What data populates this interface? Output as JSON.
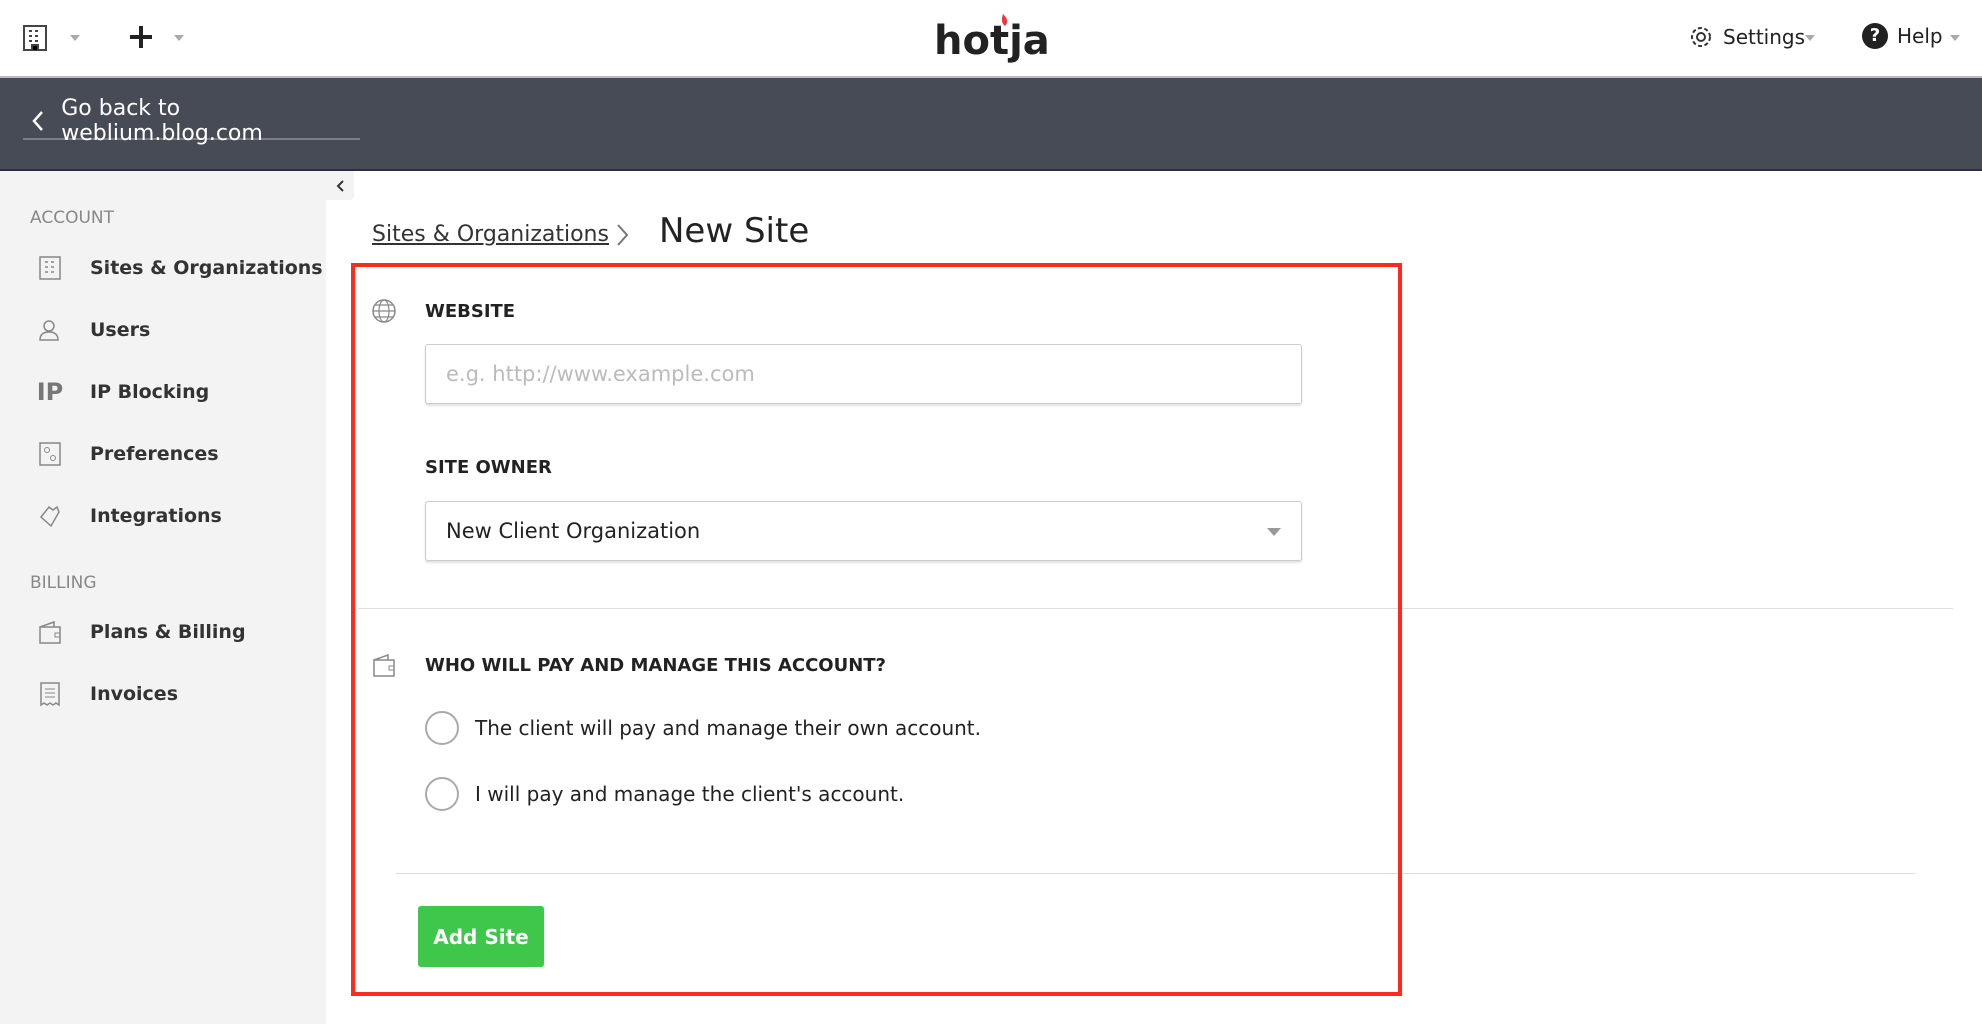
{
  "topbar": {
    "logo": "hotjar",
    "settings": "Settings",
    "help": "Help",
    "help_icon_glyph": "?"
  },
  "backbar": {
    "label": "Go back to weblium.blog.com"
  },
  "sidebar": {
    "sections": [
      {
        "title": "ACCOUNT",
        "items": [
          {
            "label": "Sites & Organizations",
            "icon": "building-icon"
          },
          {
            "label": "Users",
            "icon": "users-icon"
          },
          {
            "label": "IP Blocking",
            "icon": "ip-icon",
            "glyph": "IP"
          },
          {
            "label": "Preferences",
            "icon": "preferences-icon"
          },
          {
            "label": "Integrations",
            "icon": "integrations-icon"
          }
        ]
      },
      {
        "title": "BILLING",
        "items": [
          {
            "label": "Plans & Billing",
            "icon": "wallet-icon"
          },
          {
            "label": "Invoices",
            "icon": "invoice-icon"
          }
        ]
      }
    ]
  },
  "breadcrumb": {
    "parent": "Sites & Organizations",
    "current": "New Site"
  },
  "form": {
    "website_label": "WEBSITE",
    "website_placeholder": "e.g. http://www.example.com",
    "website_value": "",
    "owner_label": "SITE OWNER",
    "owner_value": "New Client Organization",
    "pay_label": "WHO WILL PAY AND MANAGE THIS ACCOUNT?",
    "options": [
      "The client will pay and manage their own account.",
      "I will pay and manage the client's account."
    ],
    "submit": "Add Site"
  },
  "colors": {
    "accent_green": "#3ec74a",
    "highlight_red": "#ff2a1f",
    "dark_bar": "#474b56",
    "logo_flame": "#e8383d"
  }
}
